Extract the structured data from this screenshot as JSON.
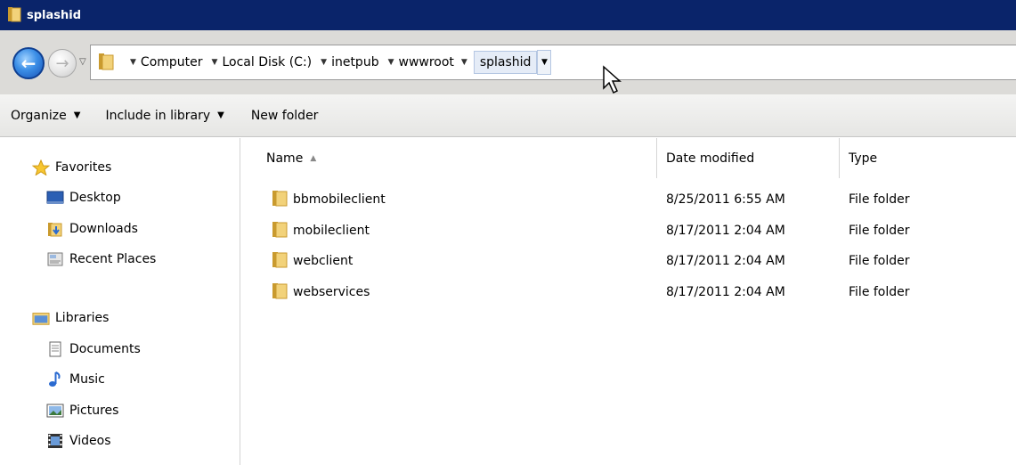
{
  "window": {
    "title": "splashid"
  },
  "address": {
    "crumbs": [
      "Computer",
      "Local Disk (C:)",
      "inetpub",
      "wwwroot"
    ],
    "current": "splashid"
  },
  "toolbar": {
    "organize": "Organize",
    "include_in_library": "Include in library",
    "new_folder": "New folder"
  },
  "nav": {
    "favorites": "Favorites",
    "desktop": "Desktop",
    "downloads": "Downloads",
    "recent_places": "Recent Places",
    "libraries": "Libraries",
    "documents": "Documents",
    "music": "Music",
    "pictures": "Pictures",
    "videos": "Videos"
  },
  "columns": {
    "name": "Name",
    "date_modified": "Date modified",
    "type": "Type"
  },
  "files": [
    {
      "name": "bbmobileclient",
      "date": "8/25/2011 6:55 AM",
      "type": "File folder"
    },
    {
      "name": "mobileclient",
      "date": "8/17/2011 2:04 AM",
      "type": "File folder"
    },
    {
      "name": "webclient",
      "date": "8/17/2011 2:04 AM",
      "type": "File folder"
    },
    {
      "name": "webservices",
      "date": "8/17/2011 2:04 AM",
      "type": "File folder"
    }
  ],
  "colors": {
    "titlebar": "#0a246a",
    "folder": "#e8c25a",
    "selection": "#e5ecf7"
  }
}
